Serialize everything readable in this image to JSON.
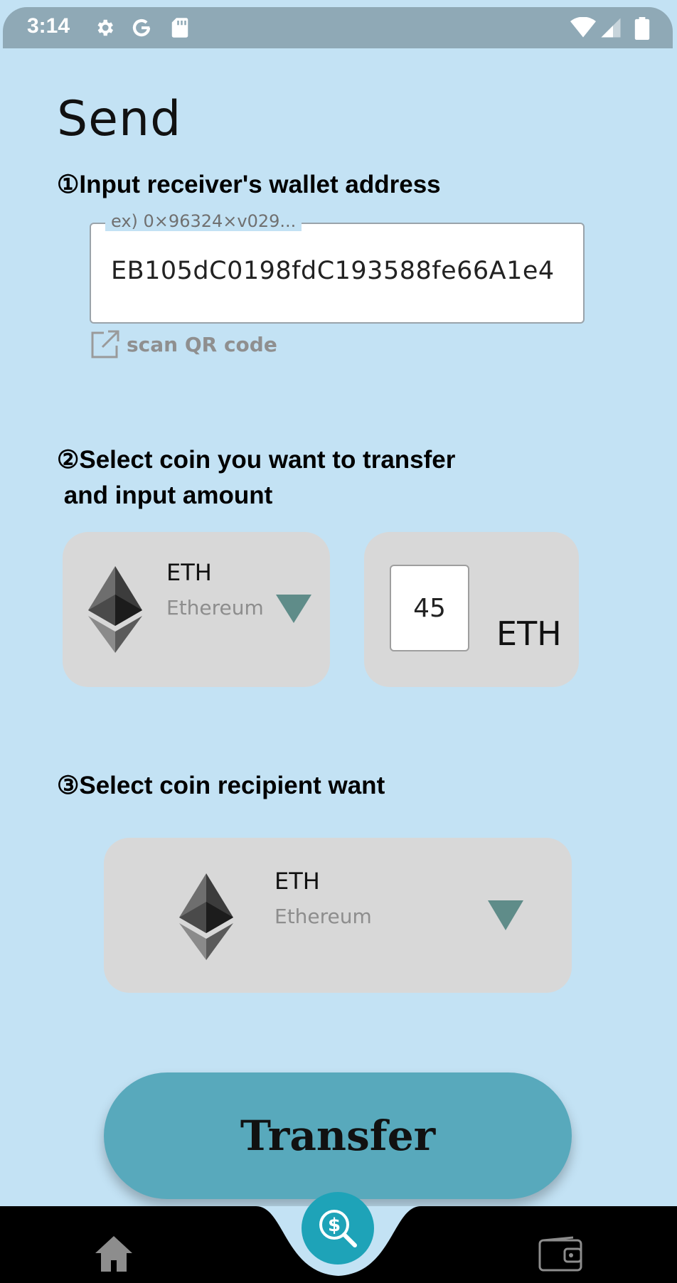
{
  "status_bar": {
    "time": "3:14",
    "left_icons": [
      "gear-icon",
      "google-g-icon",
      "sd-card-icon"
    ],
    "right_icons": [
      "wifi-icon",
      "signal-icon",
      "battery-icon"
    ]
  },
  "page": {
    "title": "Send"
  },
  "step1": {
    "heading": "①Input receiver's wallet address",
    "address_placeholder": "ex) 0×96324×v029...",
    "address_value": "EB105dC0198fdC193588fe66A1e4",
    "scan_label": "scan QR code"
  },
  "step2": {
    "heading_line1": "②Select coin you want to transfer",
    "heading_line2": " and input amount",
    "coin_symbol": "ETH",
    "coin_name": "Ethereum",
    "amount": "45",
    "amount_unit": "ETH"
  },
  "step3": {
    "heading": "③Select coin recipient want",
    "coin_symbol": "ETH",
    "coin_name": "Ethereum"
  },
  "actions": {
    "transfer_label": "Transfer"
  },
  "bottom_nav": {
    "items": [
      "home-icon",
      "search-dollar-icon",
      "wallet-icon"
    ]
  },
  "colors": {
    "background": "#c3e2f4",
    "status_bar": "#8fa9b6",
    "card": "#d8d8d8",
    "accent_button": "#58a9bc",
    "fab": "#1ea3b8",
    "dropdown_arrow": "#5f8c89"
  }
}
